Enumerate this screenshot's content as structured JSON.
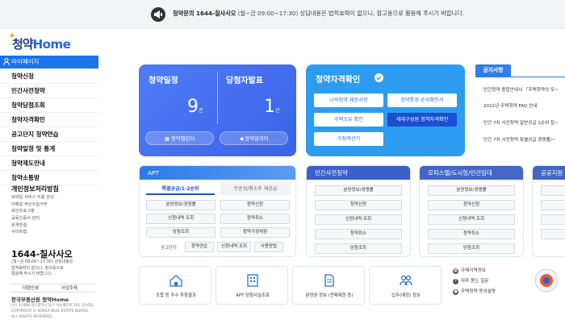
{
  "notice": {
    "icon": "megaphone-icon",
    "phone_text": "청약문의 1644-칠사사오",
    "hours": "(월~금 09:00~17:30)",
    "disclaimer": "상담내용은 법적효력이 없으니, 참고용으로 활용해 주시기 바랍니다."
  },
  "logo": {
    "ko": "청약",
    "en": "Home"
  },
  "sidebar": {
    "mypage": "마이페이지",
    "items": [
      "청약신청",
      "민간사전청약",
      "청약당첨조회",
      "청약자격확인",
      "공고단지 청약연습",
      "청약일정 및 통계",
      "청약제도안내",
      "청약소통방"
    ],
    "policy_title": "개인정보처리방침",
    "policy_links": [
      "모바일 서비스 이용 안내",
      "이메일 무단수집거부",
      "보안프로그램",
      "공동인증서 관리",
      "원격연결",
      "사이트맵"
    ],
    "phone": "1644-칠사사오",
    "phone_desc": [
      "(월~금 09:00~17:30) 상담내용은",
      "법적효력이 없으니, 참고용으로",
      "활용해 주시기 바랍니다."
    ],
    "btn_left": "대형인쇄",
    "btn_right": "사업주체",
    "footer_brand": "한국부동산원 청약Home",
    "footer_lines": [
      "(우) 41068 대구광역시 동구 이노밸리로 291 (신서동)",
      "COPYRIGHT © KOREA REAL ESTATE BOARD.",
      "ALL RIGHTS RESERVED."
    ]
  },
  "schedule_card": {
    "title_left": "청약일정",
    "count_left": "9",
    "unit": "건",
    "title_right": "당첨자발표",
    "count_right": "1",
    "btn_left": "청약캘린더",
    "btn_right": "청약알리미"
  },
  "qual_card": {
    "title": "청약자격확인",
    "buttons": [
      "나의청약 제한사항",
      "청약통장 순위확인서",
      "주택소유 확인",
      "세대구성원 청약자격확인",
      "가점계산기"
    ]
  },
  "notices": {
    "tab": "공지사항",
    "items": [
      "민간청약 종합안내서 「주택청약의 모~",
      "2022년 주택청약 FAQ 안내",
      "민간 7차 사전청약 일반공급 1순위 접~",
      "민간 7차 사전청약 특별공급 경쟁률/~"
    ]
  },
  "apt": {
    "title": "APT",
    "tab_on": "특별공급/1·2순위",
    "tab_off": "무순위/취소후 재공급",
    "buttons": [
      "분양정보/경쟁률",
      "청약신청",
      "신청내역 조회",
      "청약취소",
      "당첨조회",
      "청약가점체험"
    ],
    "bottom_label": "공고단지",
    "bottom_buttons": [
      "청약연습",
      "신청내역 조회",
      "사용방법"
    ]
  },
  "private": {
    "title": "민간사전청약",
    "buttons": [
      "분양정보/경쟁률",
      "청약신청",
      "신청내역 조회",
      "청약취소",
      "당첨조회"
    ]
  },
  "officetel": {
    "title": "오피스텔/도시형/민간임대",
    "buttons": [
      "분양정보/경쟁률",
      "청약신청",
      "신청내역 조회",
      "청약취소",
      "당첨조회"
    ]
  },
  "public": {
    "title": "공공지원"
  },
  "services": [
    {
      "icon": "house-icon",
      "label": "조합 등 주수 추첨결과"
    },
    {
      "icon": "apartment-icon",
      "label": "APT 당첨사실조회"
    },
    {
      "icon": "document-icon",
      "label": "분양권 정보 (전매제한 등)"
    },
    {
      "icon": "people-icon",
      "label": "입주(예정) 정보"
    }
  ],
  "service_list": [
    {
      "icon": "regulation-icon",
      "label": "규제지역정보"
    },
    {
      "icon": "question-icon",
      "label": "자주 묻는 질문"
    },
    {
      "icon": "person-icon",
      "label": "주택청약 동의설명"
    }
  ],
  "colors": {
    "primary": "#1a73e8",
    "schedule_card": "#4f7bf7",
    "qual_card": "#2d9cf0",
    "accent_dark": "#1b4fd1"
  }
}
